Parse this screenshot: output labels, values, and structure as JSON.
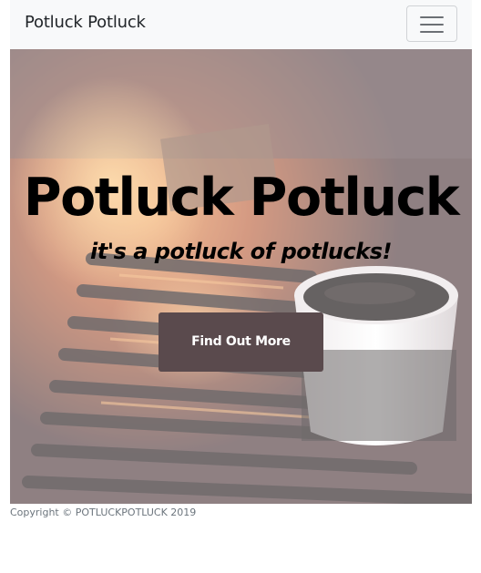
{
  "navbar": {
    "brand": "Potluck Potluck",
    "toggler_icon": "hamburger-menu-icon"
  },
  "hero": {
    "title": "Potluck Potluck",
    "subtitle": "it's a potluck of potlucks!",
    "button_label": "Find Out More",
    "background_image": "grill-fire-coffee-cup-photo"
  },
  "footer": {
    "copyright": "Copyright © POTLUCKPOTLUCK 2019"
  },
  "colors": {
    "navbar_bg": "#f8f9fa",
    "button_bg": "#5a4a4d",
    "button_text": "#ffffff",
    "footer_text": "#6c757d"
  }
}
